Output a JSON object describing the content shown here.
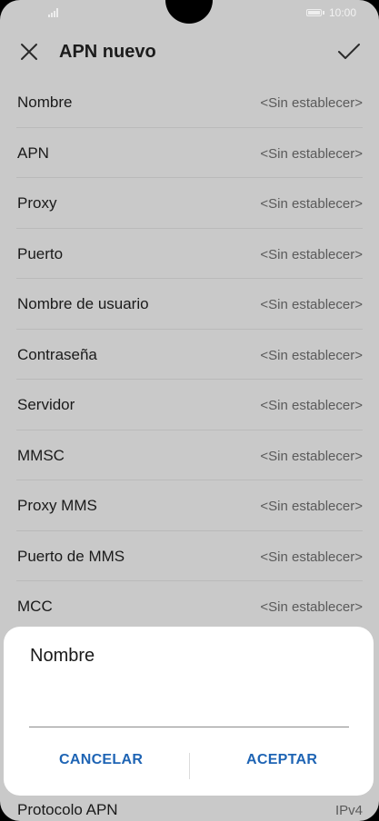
{
  "status_bar": {
    "time": "10:00",
    "icons": [
      "signal-icon",
      "battery-icon"
    ]
  },
  "toolbar": {
    "title": "APN nuevo",
    "close_icon": "close-icon",
    "confirm_icon": "check-icon"
  },
  "fields": [
    {
      "label": "Nombre",
      "value": "<Sin establecer>"
    },
    {
      "label": "APN",
      "value": "<Sin establecer>"
    },
    {
      "label": "Proxy",
      "value": "<Sin establecer>"
    },
    {
      "label": "Puerto",
      "value": "<Sin establecer>"
    },
    {
      "label": "Nombre de usuario",
      "value": "<Sin establecer>"
    },
    {
      "label": "Contraseña",
      "value": "<Sin establecer>"
    },
    {
      "label": "Servidor",
      "value": "<Sin establecer>"
    },
    {
      "label": "MMSC",
      "value": "<Sin establecer>"
    },
    {
      "label": "Proxy MMS",
      "value": "<Sin establecer>"
    },
    {
      "label": "Puerto de MMS",
      "value": "<Sin establecer>"
    },
    {
      "label": "MCC",
      "value": "<Sin establecer>"
    }
  ],
  "bottom_field": {
    "label": "Protocolo APN",
    "value": "IPv4"
  },
  "dialog": {
    "title": "Nombre",
    "input_value": "",
    "cancel_label": "CANCELAR",
    "accept_label": "ACEPTAR"
  }
}
